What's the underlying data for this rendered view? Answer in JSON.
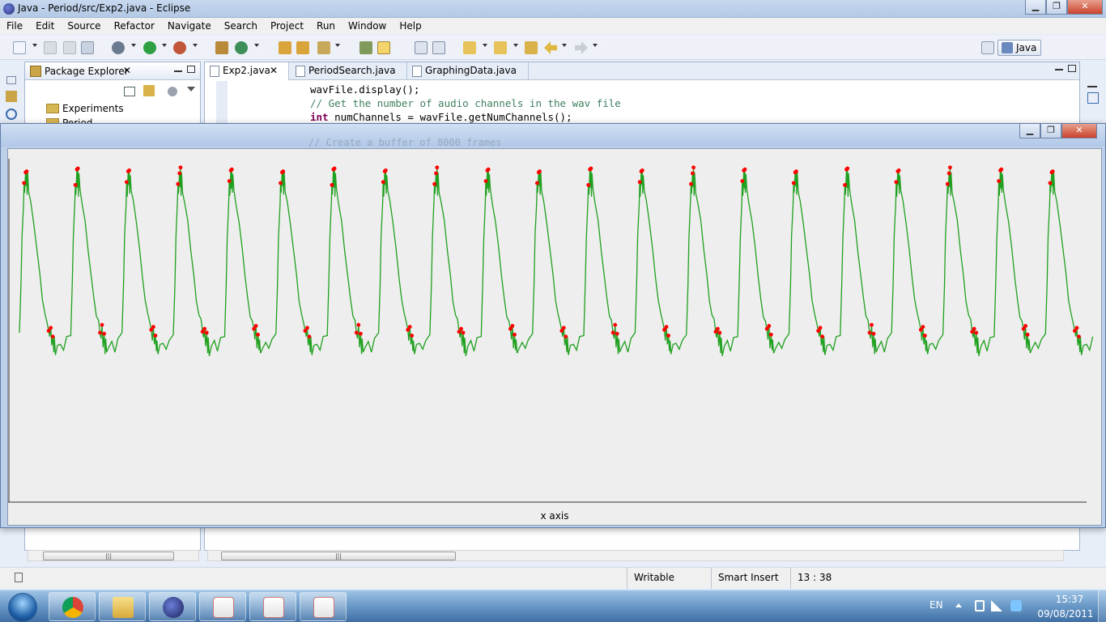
{
  "window": {
    "title": "Java - Period/src/Exp2.java - Eclipse",
    "minimize": "▁",
    "maximize": "❐",
    "close": "✕"
  },
  "menu": [
    "File",
    "Edit",
    "Source",
    "Refactor",
    "Navigate",
    "Search",
    "Project",
    "Run",
    "Window",
    "Help"
  ],
  "perspective": "Java",
  "package_explorer": {
    "title": "Package Explorer",
    "close": "✕",
    "items": [
      "Experiments",
      "Period"
    ]
  },
  "editor": {
    "tabs": [
      "Exp2.java",
      "PeriodSearch.java",
      "GraphingData.java"
    ],
    "code": {
      "line1": "wavFile.display();",
      "line2": "// Get the number of audio channels in the wav file",
      "line3_kw": "int",
      "line3_rest": " numChannels = wavFile.getNumChannels();"
    }
  },
  "graph_window": {
    "minimize": "▁",
    "maximize": "❐",
    "close": "✕",
    "ghost_text": "// Create a buffer of 8000 frames",
    "x_axis_label": "x axis",
    "series_color": "#1fa01f",
    "marker_color": "#ff0000"
  },
  "status": {
    "writable": "Writable",
    "insert_mode": "Smart Insert",
    "position": "13 : 38"
  },
  "tray": {
    "lang": "EN",
    "time": "15:37",
    "date": "09/08/2011"
  },
  "chart_data": {
    "type": "line",
    "cycles": 21,
    "grid": false,
    "xlabel": "x axis",
    "peak_markers_per_cycle": 3,
    "trough_markers_per_cycle": 3
  }
}
